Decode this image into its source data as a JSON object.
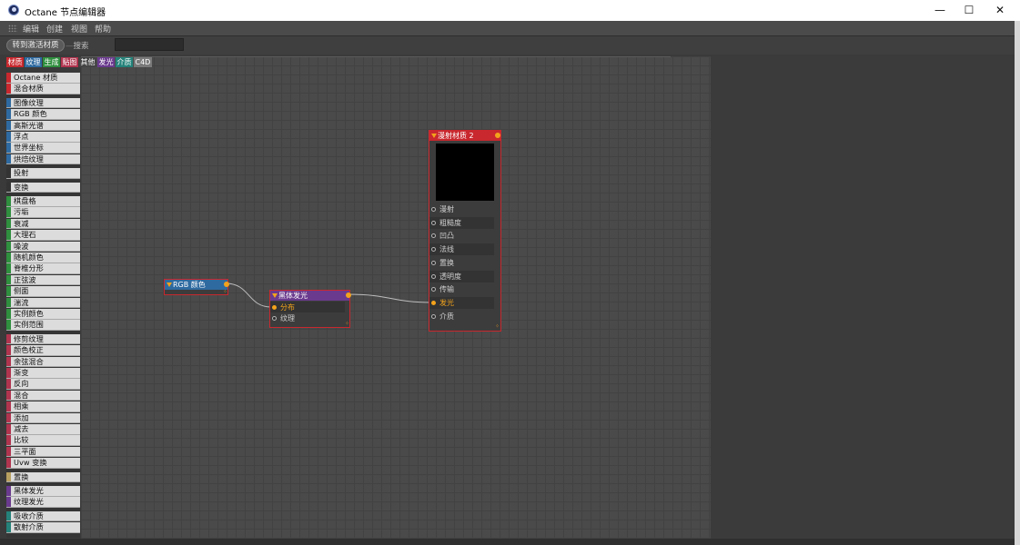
{
  "window": {
    "title": "Octane 节点编辑器",
    "minimize": "—",
    "maximize": "☐",
    "close": "✕"
  },
  "menu": [
    "编辑",
    "创建",
    "视图",
    "帮助"
  ],
  "toolbar": {
    "goto_button": "转到激活材质",
    "search_label": "搜索",
    "search_value": ""
  },
  "categories": [
    {
      "label": "材质",
      "color": "#c8282e"
    },
    {
      "label": "纹理",
      "color": "#2e6aa0"
    },
    {
      "label": "生成",
      "color": "#2f8f3e"
    },
    {
      "label": "贴图",
      "color": "#b0344e"
    },
    {
      "label": "其他",
      "color": "#444444"
    },
    {
      "label": "发光",
      "color": "#6a3a8e"
    },
    {
      "label": "介质",
      "color": "#24827a"
    },
    {
      "label": "C4D",
      "color": "#7a7a7a"
    }
  ],
  "node_list": [
    {
      "label": "Octane 材质",
      "color": "#c8282e"
    },
    {
      "label": "混合材质",
      "color": "#c8282e"
    },
    {
      "label": "图像纹理",
      "color": "#2e6aa0"
    },
    {
      "label": "RGB 颜色",
      "color": "#2e6aa0"
    },
    {
      "label": "高斯光谱",
      "color": "#2e6aa0"
    },
    {
      "label": "浮点",
      "color": "#2e6aa0"
    },
    {
      "label": "世界坐标",
      "color": "#2e6aa0"
    },
    {
      "label": "烘焙纹理",
      "color": "#2e6aa0"
    },
    {
      "label": "投射",
      "color": "#333333"
    },
    {
      "label": "变换",
      "color": "#333333"
    },
    {
      "label": "棋盘格",
      "color": "#2f8f3e"
    },
    {
      "label": "污垢",
      "color": "#2f8f3e"
    },
    {
      "label": "衰减",
      "color": "#2f8f3e"
    },
    {
      "label": "大理石",
      "color": "#2f8f3e"
    },
    {
      "label": "噪波",
      "color": "#2f8f3e"
    },
    {
      "label": "随机颜色",
      "color": "#2f8f3e"
    },
    {
      "label": "脊椎分形",
      "color": "#2f8f3e"
    },
    {
      "label": "正弦波",
      "color": "#2f8f3e"
    },
    {
      "label": "侧面",
      "color": "#2f8f3e"
    },
    {
      "label": "湍流",
      "color": "#2f8f3e"
    },
    {
      "label": "实例颜色",
      "color": "#2f8f3e"
    },
    {
      "label": "实例范围",
      "color": "#2f8f3e"
    },
    {
      "label": "修剪纹理",
      "color": "#b0344e"
    },
    {
      "label": "颜色校正",
      "color": "#b0344e"
    },
    {
      "label": "余弦混合",
      "color": "#b0344e"
    },
    {
      "label": "渐变",
      "color": "#b0344e"
    },
    {
      "label": "反向",
      "color": "#b0344e"
    },
    {
      "label": "混合",
      "color": "#b0344e"
    },
    {
      "label": "相乘",
      "color": "#b0344e"
    },
    {
      "label": "添加",
      "color": "#b0344e"
    },
    {
      "label": "减去",
      "color": "#b0344e"
    },
    {
      "label": "比较",
      "color": "#b0344e"
    },
    {
      "label": "三平面",
      "color": "#b0344e"
    },
    {
      "label": "Uvw 变换",
      "color": "#b0344e"
    },
    {
      "label": "置换",
      "color": "#b8a060"
    },
    {
      "label": "黑体发光",
      "color": "#6a3a8e"
    },
    {
      "label": "纹理发光",
      "color": "#6a3a8e"
    },
    {
      "label": "吸收介质",
      "color": "#24827a"
    },
    {
      "label": "散射介质",
      "color": "#24827a"
    }
  ],
  "nodes": {
    "rgb": {
      "title": "RGB 颜色",
      "color": "#2e6aa0"
    },
    "blackbody": {
      "title": "黑体发光",
      "color": "#6a3a8e",
      "pins": [
        {
          "label": "分布",
          "connected": true
        },
        {
          "label": "纹理",
          "connected": false
        }
      ]
    },
    "diffuse": {
      "title": "漫射材质 2",
      "color": "#c8282e",
      "pins": [
        {
          "label": "漫射",
          "connected": false
        },
        {
          "label": "粗糙度",
          "connected": false
        },
        {
          "label": "凹凸",
          "connected": false
        },
        {
          "label": "法线",
          "connected": false
        },
        {
          "label": "置换",
          "connected": false
        },
        {
          "label": "透明度",
          "connected": false
        },
        {
          "label": "传输",
          "connected": false
        },
        {
          "label": "发光",
          "connected": true
        },
        {
          "label": "介质",
          "connected": false
        }
      ]
    }
  },
  "colors": {
    "accent": "#f2a31c",
    "wire": "#b8b8b8"
  }
}
